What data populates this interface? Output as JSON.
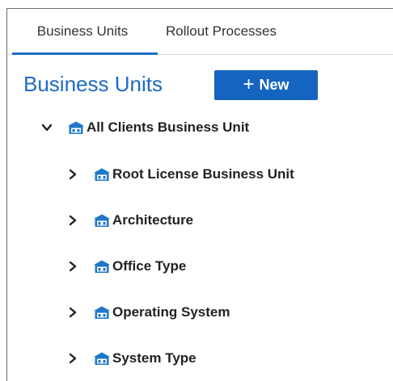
{
  "tabs": [
    {
      "label": "Business Units",
      "active": true
    },
    {
      "label": "Rollout Processes",
      "active": false
    }
  ],
  "heading": "Business Units",
  "new_button": {
    "icon": "plus-icon",
    "label": "New"
  },
  "colors": {
    "accent": "#1565c0",
    "heading": "#1d6bc6",
    "icon": "#1f78c8"
  },
  "tree": {
    "root": {
      "label": "All Clients Business Unit",
      "expanded": true,
      "icon": "business-unit-icon"
    },
    "children": [
      {
        "label": "Root License Business Unit",
        "expanded": false,
        "icon": "business-unit-icon"
      },
      {
        "label": "Architecture",
        "expanded": false,
        "icon": "business-unit-icon"
      },
      {
        "label": "Office Type",
        "expanded": false,
        "icon": "business-unit-icon"
      },
      {
        "label": "Operating System",
        "expanded": false,
        "icon": "business-unit-icon"
      },
      {
        "label": "System Type",
        "expanded": false,
        "icon": "business-unit-icon"
      }
    ]
  }
}
